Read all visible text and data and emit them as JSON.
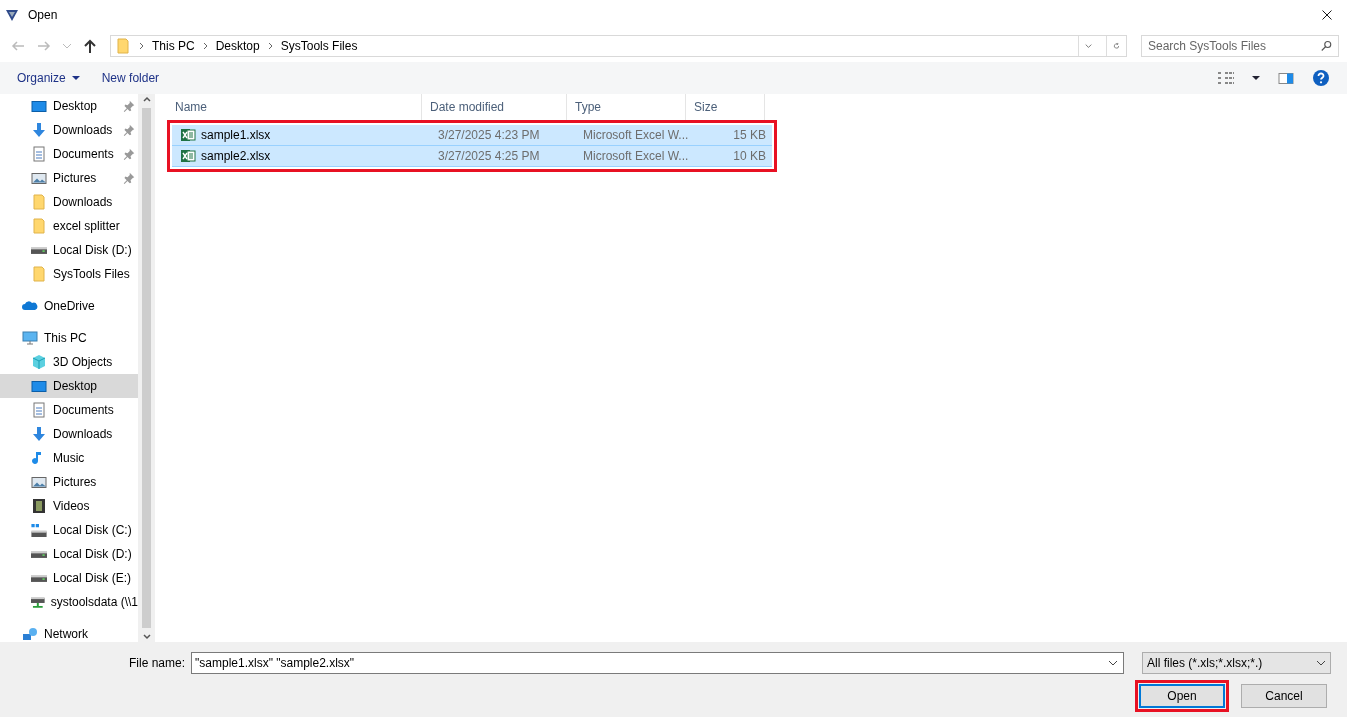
{
  "window": {
    "title": "Open"
  },
  "address": {
    "crumbs": [
      "This PC",
      "Desktop",
      "SysTools Files"
    ],
    "search_placeholder": "Search SysTools Files"
  },
  "toolbar": {
    "organize": "Organize",
    "new_folder": "New folder"
  },
  "sidebar": {
    "quick_access": [
      {
        "label": "Desktop",
        "kind": "desktop",
        "pinned": true,
        "selected": false
      },
      {
        "label": "Downloads",
        "kind": "download",
        "pinned": true,
        "selected": false
      },
      {
        "label": "Documents",
        "kind": "document",
        "pinned": true,
        "selected": false
      },
      {
        "label": "Pictures",
        "kind": "picture",
        "pinned": true,
        "selected": false
      },
      {
        "label": "Downloads",
        "kind": "folder",
        "pinned": false,
        "selected": false
      },
      {
        "label": "excel splitter",
        "kind": "folder",
        "pinned": false,
        "selected": false
      },
      {
        "label": "Local Disk (D:)",
        "kind": "drive",
        "pinned": false,
        "selected": false
      },
      {
        "label": "SysTools Files",
        "kind": "folder",
        "pinned": false,
        "selected": false
      }
    ],
    "locations": [
      {
        "label": "OneDrive",
        "kind": "cloud",
        "selected": false
      },
      {
        "label": "This PC",
        "kind": "pc",
        "selected": false,
        "children": [
          {
            "label": "3D Objects",
            "kind": "cube",
            "selected": false
          },
          {
            "label": "Desktop",
            "kind": "desktop",
            "selected": true
          },
          {
            "label": "Documents",
            "kind": "document",
            "selected": false
          },
          {
            "label": "Downloads",
            "kind": "download",
            "selected": false
          },
          {
            "label": "Music",
            "kind": "music",
            "selected": false
          },
          {
            "label": "Pictures",
            "kind": "picture",
            "selected": false
          },
          {
            "label": "Videos",
            "kind": "video",
            "selected": false
          },
          {
            "label": "Local Disk (C:)",
            "kind": "windrive",
            "selected": false
          },
          {
            "label": "Local Disk (D:)",
            "kind": "drive",
            "selected": false
          },
          {
            "label": "Local Disk (E:)",
            "kind": "drive",
            "selected": false
          },
          {
            "label": "systoolsdata (\\\\1",
            "kind": "netdrive",
            "selected": false
          }
        ]
      },
      {
        "label": "Network",
        "kind": "network",
        "selected": false
      }
    ]
  },
  "table": {
    "columns": [
      "Name",
      "Date modified",
      "Type",
      "Size"
    ],
    "annotated": true,
    "rows": [
      {
        "name": "sample1.xlsx",
        "date": "3/27/2025 4:23 PM",
        "type": "Microsoft Excel W...",
        "size": "15 KB",
        "selected": true
      },
      {
        "name": "sample2.xlsx",
        "date": "3/27/2025 4:25 PM",
        "type": "Microsoft Excel W...",
        "size": "10 KB",
        "selected": true
      }
    ]
  },
  "footer": {
    "file_name_label": "File name:",
    "file_name": "\"sample1.xlsx\" \"sample2.xlsx\"",
    "filter": "All files (*.xls;*.xlsx;*.)",
    "buttons": [
      {
        "label": "Open",
        "kind": "primary",
        "annotated": true
      },
      {
        "label": "Cancel",
        "kind": "normal",
        "annotated": false
      }
    ]
  }
}
